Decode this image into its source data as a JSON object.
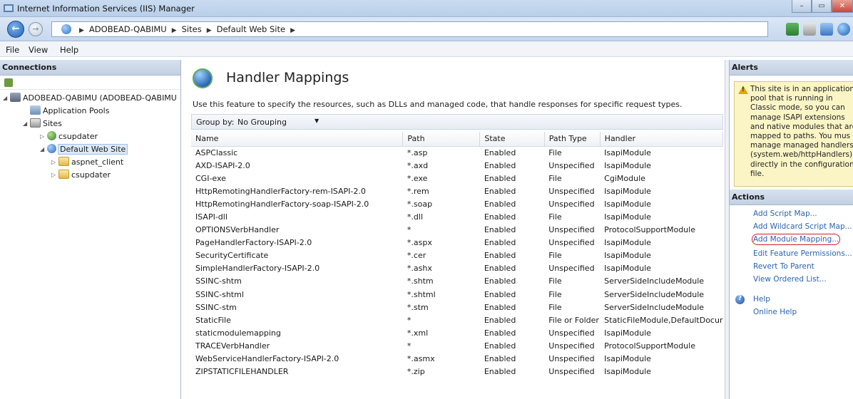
{
  "window": {
    "title": "Internet Information Services (IIS) Manager"
  },
  "address": {
    "breadcrumbs": [
      "ADOBEAD-QABIMU",
      "Sites",
      "Default Web Site"
    ],
    "separator": "▶"
  },
  "menu": {
    "file": "File",
    "view": "View",
    "help": "Help"
  },
  "connections": {
    "title": "Connections",
    "tree": {
      "server": "ADOBEAD-QABIMU (ADOBEAD-QABIMU",
      "app_pools": "Application Pools",
      "sites": "Sites",
      "site_csupdater": "csupdater",
      "default_site": "Default Web Site",
      "aspnet_client": "aspnet_client",
      "csupdater_folder": "csupdater"
    }
  },
  "main": {
    "title": "Handler Mappings",
    "description": "Use this feature to specify the resources, such as DLLs and managed code, that handle responses for specific request types.",
    "group_by_label": "Group by:",
    "group_by_value": "No Grouping",
    "columns": {
      "name": "Name",
      "path": "Path",
      "state": "State",
      "path_type": "Path Type",
      "handler": "Handler"
    },
    "rows": [
      [
        "ASPClassic",
        "*.asp",
        "Enabled",
        "File",
        "IsapiModule"
      ],
      [
        "AXD-ISAPI-2.0",
        "*.axd",
        "Enabled",
        "Unspecified",
        "IsapiModule"
      ],
      [
        "CGI-exe",
        "*.exe",
        "Enabled",
        "File",
        "CgiModule"
      ],
      [
        "HttpRemotingHandlerFactory-rem-ISAPI-2.0",
        "*.rem",
        "Enabled",
        "Unspecified",
        "IsapiModule"
      ],
      [
        "HttpRemotingHandlerFactory-soap-ISAPI-2.0",
        "*.soap",
        "Enabled",
        "Unspecified",
        "IsapiModule"
      ],
      [
        "ISAPI-dll",
        "*.dll",
        "Enabled",
        "File",
        "IsapiModule"
      ],
      [
        "OPTIONSVerbHandler",
        "*",
        "Enabled",
        "Unspecified",
        "ProtocolSupportModule"
      ],
      [
        "PageHandlerFactory-ISAPI-2.0",
        "*.aspx",
        "Enabled",
        "Unspecified",
        "IsapiModule"
      ],
      [
        "SecurityCertificate",
        "*.cer",
        "Enabled",
        "File",
        "IsapiModule"
      ],
      [
        "SimpleHandlerFactory-ISAPI-2.0",
        "*.ashx",
        "Enabled",
        "Unspecified",
        "IsapiModule"
      ],
      [
        "SSINC-shtm",
        "*.shtm",
        "Enabled",
        "File",
        "ServerSideIncludeModule"
      ],
      [
        "SSINC-shtml",
        "*.shtml",
        "Enabled",
        "File",
        "ServerSideIncludeModule"
      ],
      [
        "SSINC-stm",
        "*.stm",
        "Enabled",
        "File",
        "ServerSideIncludeModule"
      ],
      [
        "StaticFile",
        "*",
        "Enabled",
        "File or Folder",
        "StaticFileModule,DefaultDocur"
      ],
      [
        "staticmodulemapping",
        "*.xml",
        "Enabled",
        "Unspecified",
        "IsapiModule"
      ],
      [
        "TRACEVerbHandler",
        "*",
        "Enabled",
        "Unspecified",
        "ProtocolSupportModule"
      ],
      [
        "WebServiceHandlerFactory-ISAPI-2.0",
        "*.asmx",
        "Enabled",
        "Unspecified",
        "IsapiModule"
      ],
      [
        "ZIPSTATICFILEHANDLER",
        "*.zip",
        "Enabled",
        "Unspecified",
        "IsapiModule"
      ]
    ]
  },
  "alerts": {
    "title": "Alerts",
    "lines": [
      "This site is in an application",
      "pool that is running in",
      "Classic mode, so you can",
      "manage ISAPI extensions",
      "and native modules that are",
      "mapped to paths. You mus",
      "manage managed handlers",
      "(system.web/httpHandlers)",
      "directly in the configuration",
      "file."
    ]
  },
  "actions": {
    "title": "Actions",
    "items": [
      "Add Script Map...",
      "Add Wildcard Script Map...",
      "Add Module Mapping...",
      "Edit Feature Permissions...",
      "Revert To Parent",
      "View Ordered List..."
    ],
    "help": "Help",
    "online_help": "Online Help"
  }
}
